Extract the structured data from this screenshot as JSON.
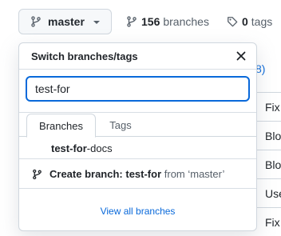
{
  "repo_bar": {
    "branch_button_label": "master",
    "branches_count": "156",
    "branches_label": "branches",
    "tags_count": "0",
    "tags_label": "tags"
  },
  "background": {
    "link_fragment": "8)",
    "row_fragments": [
      "Fix",
      "Blo",
      "Blo",
      "Use",
      "Fix"
    ]
  },
  "dropdown": {
    "title": "Switch branches/tags",
    "filter_value": "test-for",
    "tabs": [
      {
        "label": "Branches",
        "selected": true
      },
      {
        "label": "Tags",
        "selected": false
      }
    ],
    "suggestion": {
      "match": "test-for",
      "rest": "-docs"
    },
    "create": {
      "prefix": "Create branch: test-for",
      "suffix": " from ‘master’"
    },
    "view_all_label": "View all branches"
  },
  "colors": {
    "accent": "#0969da",
    "border": "#d0d7de",
    "muted_text": "#57606a"
  }
}
